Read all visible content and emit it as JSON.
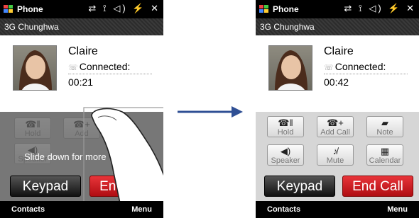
{
  "titlebar": {
    "app": "Phone"
  },
  "carrier": "3G Chunghwa",
  "contact": {
    "name": "Claire",
    "status": "Connected:"
  },
  "before": {
    "timer": "00:21",
    "buttons": {
      "hold": "Hold",
      "add": "Add",
      "speaker": "Speaker"
    },
    "hint": "Slide down for more",
    "keypad": "Keypad",
    "endcall": "End Call"
  },
  "after": {
    "timer": "00:42",
    "buttons": {
      "hold": "Hold",
      "addcall": "Add Call",
      "note": "Note",
      "speaker": "Speaker",
      "mute": "Mute",
      "calendar": "Calendar"
    },
    "keypad": "Keypad",
    "endcall": "End Call"
  },
  "softkeys": {
    "left": "Contacts",
    "right": "Menu"
  },
  "colors": {
    "arrow": "#2f4f94",
    "endcall": "#d0181d",
    "keypad": "#222222"
  },
  "icons": [
    "windows-logo-icon",
    "tray-icons",
    "connected-icon",
    "hold-icon",
    "add-call-icon",
    "note-icon",
    "speaker-icon",
    "mute-icon",
    "calendar-icon",
    "finger-gesture-icon",
    "arrow-right-icon"
  ]
}
